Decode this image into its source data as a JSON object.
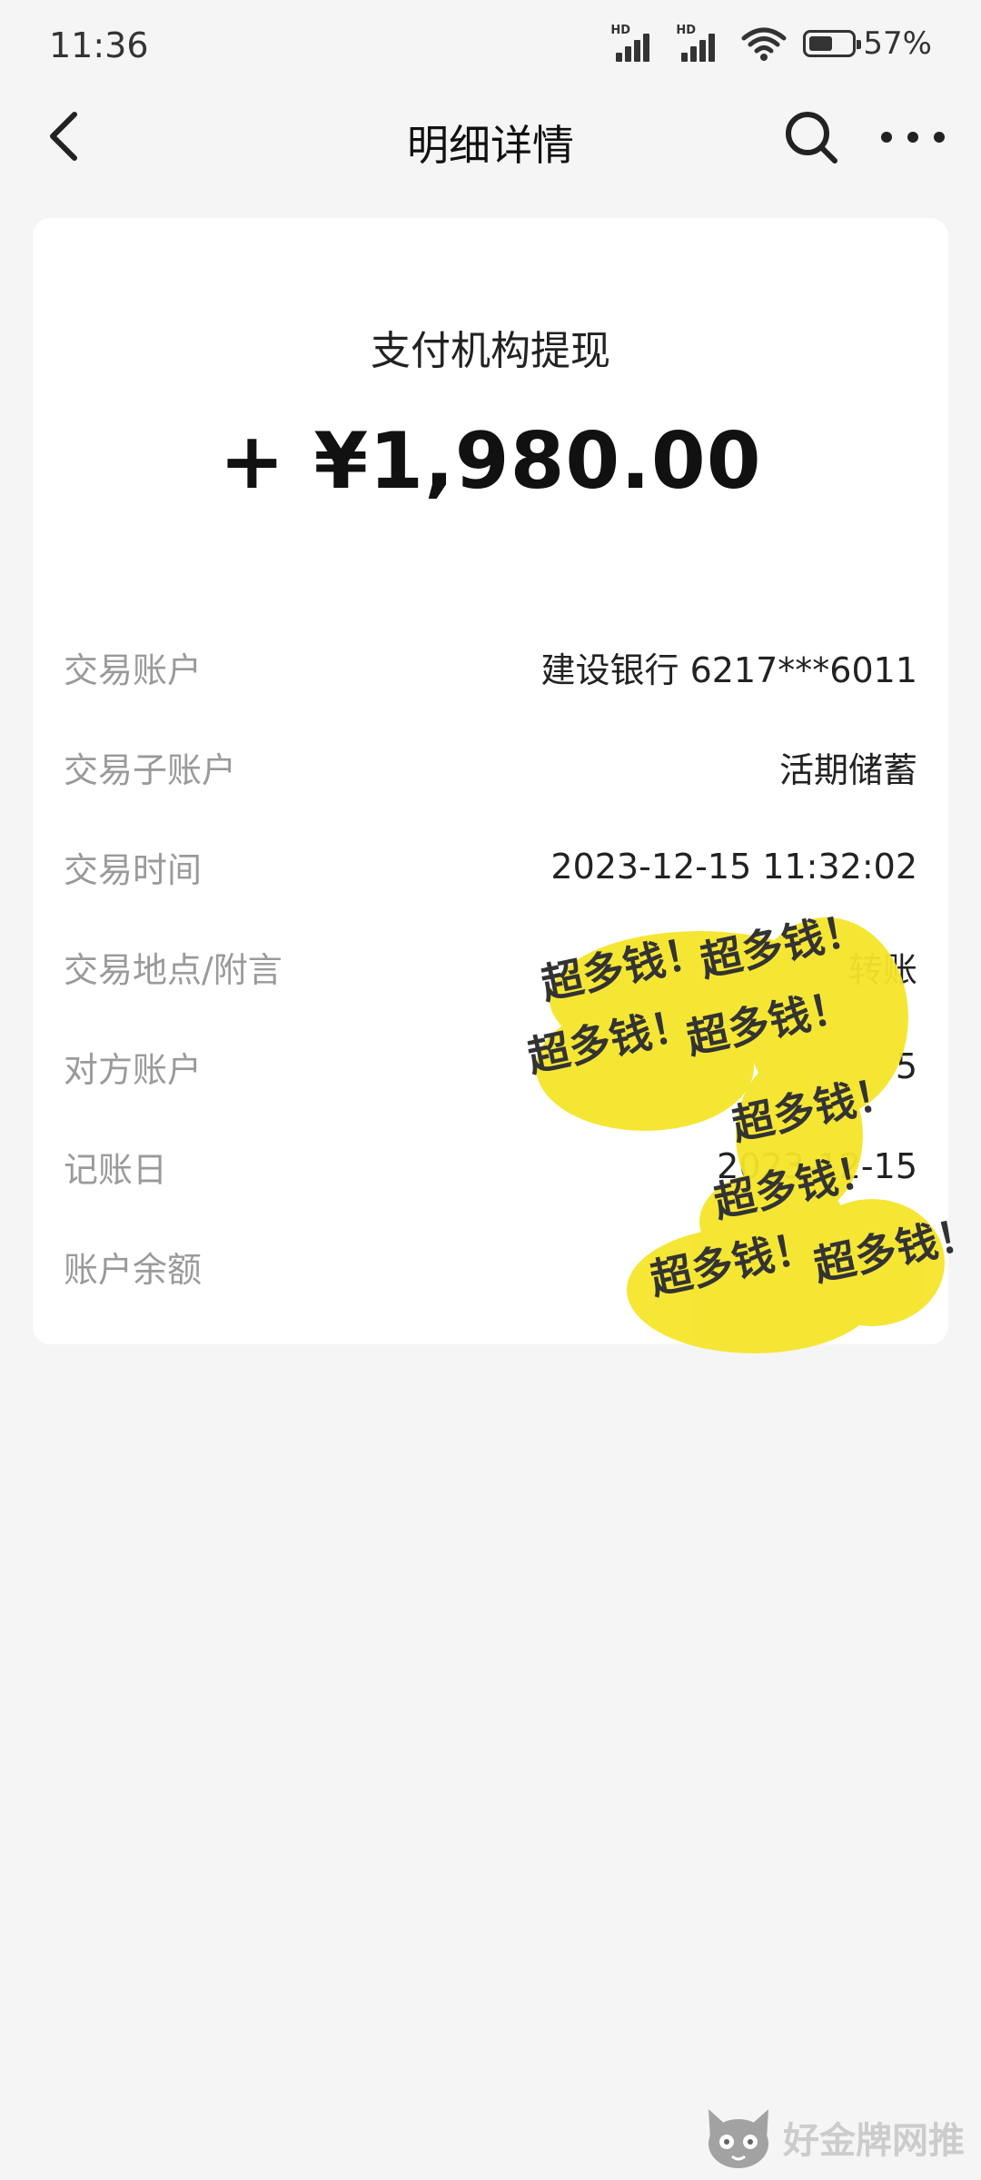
{
  "status_bar": {
    "time": "11:36",
    "battery_percent": 57,
    "battery_text": "57%",
    "network_label": "HD"
  },
  "nav": {
    "title": "明细详情",
    "back_icon": "chevron-left-icon",
    "search_icon": "search-icon",
    "more_icon": "more-horizontal-icon"
  },
  "transaction": {
    "title": "支付机构提现",
    "amount": "+ ¥1,980.00",
    "rows": [
      {
        "label": "交易账户",
        "value": "建设银行 6217***6011"
      },
      {
        "label": "交易子账户",
        "value": "活期储蓄"
      },
      {
        "label": "交易时间",
        "value": "2023-12-15 11:32:02"
      },
      {
        "label": "交易地点/附言",
        "value": "转账"
      },
      {
        "label": "对方账户",
        "value": "5"
      },
      {
        "label": "记账日",
        "value": "2023-12-15"
      },
      {
        "label": "账户余额",
        "value": ""
      }
    ]
  },
  "sticker": {
    "text": "超多钱！",
    "color": "#f5e52a"
  },
  "watermark": {
    "text": "好金牌网推",
    "icon": "cat-logo-icon"
  },
  "colors": {
    "background": "#f5f5f5",
    "card": "#ffffff",
    "label": "#9a9a9a",
    "value": "#222222"
  }
}
